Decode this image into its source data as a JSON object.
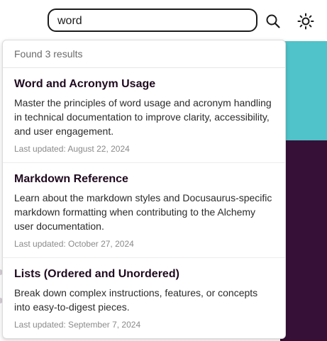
{
  "search": {
    "value": "word",
    "search_icon": "search-icon",
    "theme_icon": "sun-icon"
  },
  "results": {
    "count_text": "Found 3 results",
    "items": [
      {
        "title": "Word and Acronym Usage",
        "description": "Master the principles of word usage and acronym handling in technical documentation to improve clarity, accessibility, and user engagement.",
        "updated": "Last updated: August 22, 2024"
      },
      {
        "title": "Markdown Reference",
        "description": "Learn about the markdown styles and Docusaurus-specific markdown formatting when contributing to the Alchemy user documentation.",
        "updated": "Last updated: October 27, 2024"
      },
      {
        "title": "Lists (Ordered and Unordered)",
        "description": "Break down complex instructions, features, or concepts into easy-to-digest pieces.",
        "updated": "Last updated: September 7, 2024"
      }
    ]
  },
  "colors": {
    "teal": "#4fc3c9",
    "purple": "#371037"
  }
}
